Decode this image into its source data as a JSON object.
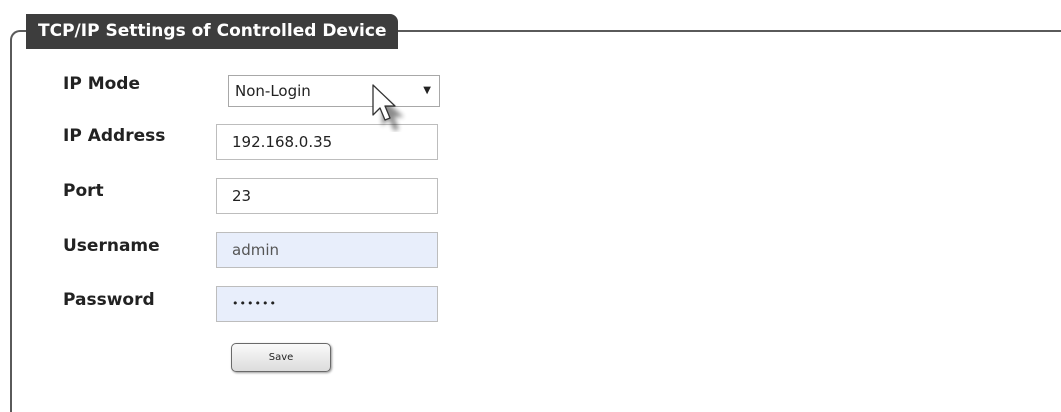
{
  "panel": {
    "title": "TCP/IP Settings of Controlled Device"
  },
  "form": {
    "ip_mode": {
      "label": "IP Mode",
      "value": "Non-Login"
    },
    "ip_address": {
      "label": "IP Address",
      "value": "192.168.0.35"
    },
    "port": {
      "label": "Port",
      "value": "23"
    },
    "username": {
      "label": "Username",
      "value": "admin"
    },
    "password": {
      "label": "Password",
      "value": "••••••"
    },
    "save_label": "Save"
  },
  "icons": {
    "dropdown": "chevron-down-icon",
    "cursor": "mouse-pointer-icon"
  }
}
